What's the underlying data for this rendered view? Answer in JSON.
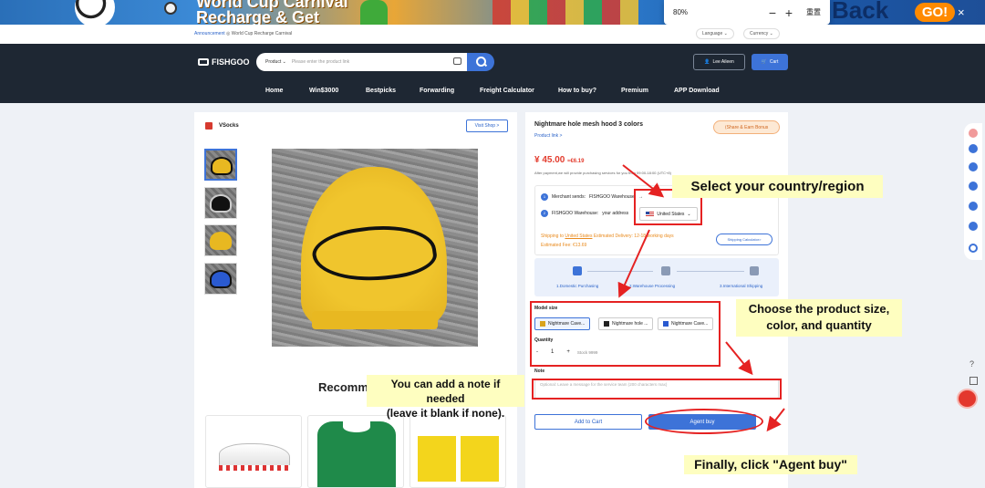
{
  "banner": {
    "title_line1": "World Cup Carnival",
    "title_line2": "Recharge & Get",
    "back_text": "Back",
    "go_label": "GO!",
    "close": "×"
  },
  "zoom": {
    "value": "80%",
    "minus": "−",
    "plus": "+",
    "reset": "重置"
  },
  "topstrip": {
    "announcement_label": "Announcement",
    "announcement_text": "World Cup Recharge Carnival",
    "language": "Language ⌄",
    "currency": "Currency ⌄"
  },
  "header": {
    "logo": "FISHGOO",
    "search_category": "Product ⌄",
    "search_placeholder": "Please enter the product link",
    "user": "Lee Aileen",
    "cart": "Cart",
    "nav": [
      "Home",
      "Win$3000",
      "Bestpicks",
      "Forwarding",
      "Freight Calculator",
      "How to buy?",
      "Premium",
      "APP Download"
    ]
  },
  "shop": {
    "name": "VSocks",
    "visit": "Visit Shop >"
  },
  "recommend_title": "Recomm",
  "product": {
    "title": "Nightmare hole mesh hood 3 colors",
    "link": "Product link >",
    "share": "Share & Earn Bonus",
    "price": "¥ 45.00",
    "price_alt": "≈€6.19",
    "price_note": "After payment,we will provide purchasing services for you from 09:00-18:00 (UTC+8)",
    "merchant_label": "Merchant sends:",
    "merchant_value": "FISHGOO Warehouse",
    "warehouse_label": "FISHGOO Warehouse:",
    "warehouse_value": "your address",
    "country": "United States",
    "shipping_line": "Shipping to",
    "shipping_country": "United States",
    "delivery": "Estimated Delivery: 12-18 working days",
    "fee": "Estimated Fee: €13.69",
    "ship_calc": "Shipping Calculator>",
    "steps": [
      "1.Domestic Purchasing",
      "2.Warehouse Processing",
      "3.International Shipping"
    ],
    "model_label": "Model size",
    "options": [
      "Nightmare Cave...",
      "Nightmare hole ...",
      "Nightmare Cave..."
    ],
    "quantity_label": "Quantity",
    "qty_minus": "-",
    "qty_value": "1",
    "qty_plus": "+",
    "stock": "Stock 9999",
    "note_label": "Note",
    "note_placeholder": "Optional: Leave a message for the service team (200 characters max)",
    "add_to_cart": "Add to Cart",
    "agent_buy": "Agent buy"
  },
  "annotations": {
    "country": "Select your country/region",
    "size_line1": "Choose the product size,",
    "size_line2": "color, and quantity",
    "note_line1": "You can add a note if needed",
    "note_line2": "(leave it blank if none).",
    "agent": "Finally, click \"Agent buy\""
  },
  "colors": {
    "accent": "#3d73d8",
    "header": "#1e2733",
    "price": "#e33d2f",
    "annotation": "#e52222",
    "callout_bg": "#fefec0"
  }
}
